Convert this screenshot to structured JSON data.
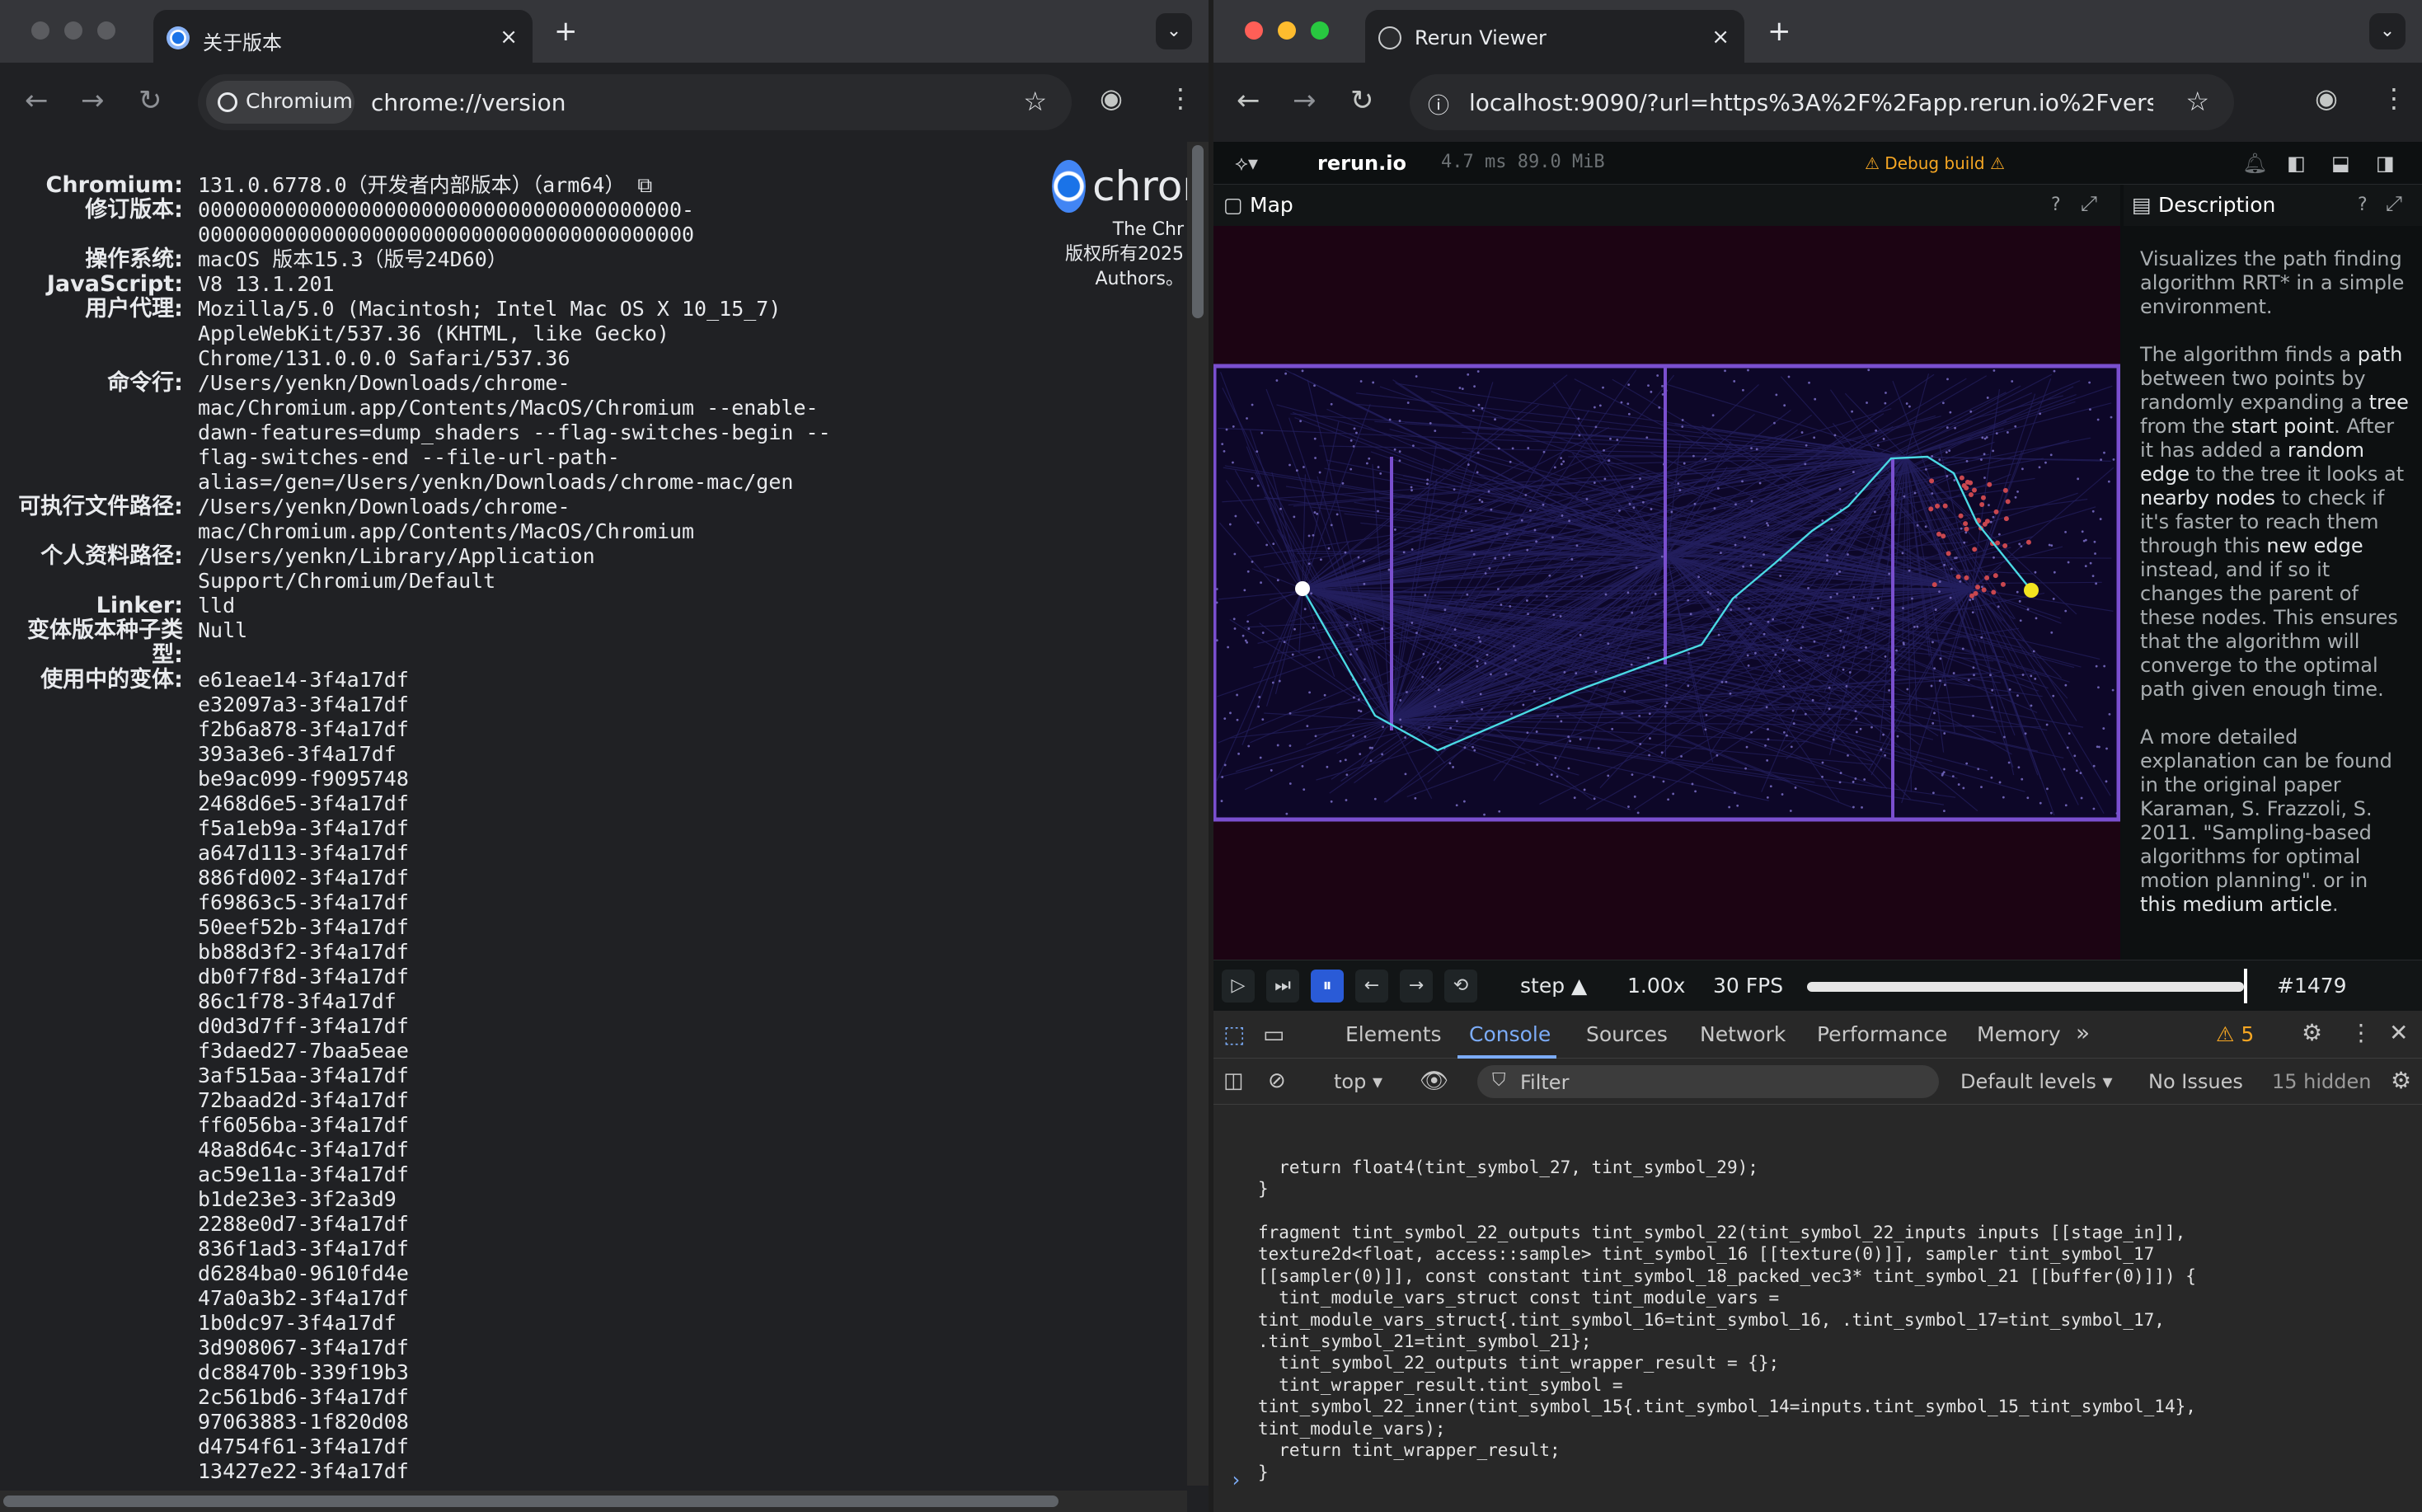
{
  "left_window": {
    "tab_title": "关于版本",
    "close": "×",
    "new_tab": "+",
    "dropdown": "⌄",
    "chip_label": "Chromium",
    "url": "chrome://version",
    "logo_text": "chron",
    "logo_caption": [
      "The Chr",
      "版权所有2025",
      "Authors。"
    ],
    "rows": [
      {
        "label": "Chromium:",
        "value": "131.0.6778.0（开发者内部版本）（arm64） ⧉"
      },
      {
        "label": "修订版本:",
        "value": "000000000000000000000000000000000000000-\n0000000000000000000000000000000000000000"
      },
      {
        "label": "操作系统:",
        "value": "macOS 版本15.3（版号24D60）"
      },
      {
        "label": "JavaScript:",
        "value": "V8 13.1.201"
      },
      {
        "label": "用户代理:",
        "value": "Mozilla/5.0 (Macintosh; Intel Mac OS X 10_15_7)\nAppleWebKit/537.36 (KHTML, like Gecko)\nChrome/131.0.0.0 Safari/537.36"
      },
      {
        "label": "命令行:",
        "value": "/Users/yenkn/Downloads/chrome-\nmac/Chromium.app/Contents/MacOS/Chromium --enable-\ndawn-features=dump_shaders --flag-switches-begin --\nflag-switches-end --file-url-path-\nalias=/gen=/Users/yenkn/Downloads/chrome-mac/gen"
      },
      {
        "label": "可执行文件路径:",
        "value": "/Users/yenkn/Downloads/chrome-\nmac/Chromium.app/Contents/MacOS/Chromium"
      },
      {
        "label": "个人资料路径:",
        "value": "/Users/yenkn/Library/Application\nSupport/Chromium/Default"
      },
      {
        "label": "Linker:",
        "value": "lld"
      },
      {
        "label": "变体版本种子类型:",
        "value": "Null"
      },
      {
        "label": "使用中的变体:",
        "value": "e61eae14-3f4a17df\ne32097a3-3f4a17df\nf2b6a878-3f4a17df\n393a3e6-3f4a17df\nbe9ac099-f9095748\n2468d6e5-3f4a17df\nf5a1eb9a-3f4a17df\na647d113-3f4a17df\n886fd002-3f4a17df\nf69863c5-3f4a17df\n50eef52b-3f4a17df\nbb88d3f2-3f4a17df\ndb0f7f8d-3f4a17df\n86c1f78-3f4a17df\nd0d3d7ff-3f4a17df\nf3daed27-7baa5eae\n3af515aa-3f4a17df\n72baad2d-3f4a17df\nff6056ba-3f4a17df\n48a8d64c-3f4a17df\nac59e11a-3f4a17df\nb1de23e3-3f2a3d9\n2288e0d7-3f4a17df\n836f1ad3-3f4a17df\nd6284ba0-9610fd4e\n47a0a3b2-3f4a17df\n1b0dc97-3f4a17df\n3d908067-3f4a17df\ndc88470b-339f19b3\n2c561bd6-3f4a17df\n97063883-1f820d08\nd4754f61-3f4a17df\n13427e22-3f4a17df"
      }
    ]
  },
  "right_window": {
    "tab_title": "Rerun Viewer",
    "close": "×",
    "new_tab": "+",
    "url": "localhost:9090/?url=https%3A%2F%2Fapp.rerun.io%2Fversion%...",
    "rerun": {
      "app_name": "rerun.io",
      "perf": "4.7 ms 89.0 MiB",
      "debug_badge": "⚠ Debug build ⚠",
      "map_title": "Map",
      "description_title": "Description",
      "help": "?",
      "description": [
        [
          {
            "t": "Visualizes the path finding algorithm RRT* in a simple environment.",
            "b": false
          }
        ],
        [
          {
            "t": "The algorithm finds a ",
            "b": false
          },
          {
            "t": "path",
            "b": true
          },
          {
            "t": " between two points by randomly expanding a ",
            "b": false
          },
          {
            "t": "tree",
            "b": true
          },
          {
            "t": " from the ",
            "b": false
          },
          {
            "t": "start point",
            "b": true
          },
          {
            "t": ". After it has added a ",
            "b": false
          },
          {
            "t": "random edge",
            "b": true
          },
          {
            "t": " to the tree it looks at ",
            "b": false
          },
          {
            "t": "nearby nodes",
            "b": true
          },
          {
            "t": " to check if it's faster to reach them through this ",
            "b": false
          },
          {
            "t": "new edge",
            "b": true
          },
          {
            "t": " instead, and if so it changes the parent of these nodes. This ensures that the algorithm will converge to the optimal path given enough time.",
            "b": false
          }
        ],
        [
          {
            "t": "A more detailed explanation can be found in the original paper Karaman, S. Frazzoli, S. 2011. \"Sampling-based algorithms for optimal motion planning\". or in ",
            "b": false
          },
          {
            "t": "this medium article",
            "b": true
          },
          {
            "t": ".",
            "b": false
          }
        ]
      ],
      "timebar": {
        "step_label": "step ▲",
        "speed": "1.00x",
        "fps": "30 FPS",
        "frame": "#1479"
      }
    },
    "devtools": {
      "tabs": [
        "Elements",
        "Console",
        "Sources",
        "Network",
        "Performance",
        "Memory"
      ],
      "active_tab": "Console",
      "more": "»",
      "warnings": "⚠ 5",
      "context": "top ▾",
      "filter_placeholder": "Filter",
      "levels": "Default levels ▾",
      "issues": "No Issues",
      "hidden": "15 hidden",
      "console_text": "  return float4(tint_symbol_27, tint_symbol_29);\n}\n\nfragment tint_symbol_22_outputs tint_symbol_22(tint_symbol_22_inputs inputs [[stage_in]],\ntexture2d<float, access::sample> tint_symbol_16 [[texture(0)]], sampler tint_symbol_17\n[[sampler(0)]], const constant tint_symbol_18_packed_vec3* tint_symbol_21 [[buffer(0)]]) {\n  tint_module_vars_struct const tint_module_vars =\ntint_module_vars_struct{.tint_symbol_16=tint_symbol_16, .tint_symbol_17=tint_symbol_17,\n.tint_symbol_21=tint_symbol_21};\n  tint_symbol_22_outputs tint_wrapper_result = {};\n  tint_wrapper_result.tint_symbol =\ntint_symbol_22_inner(tint_symbol_15{.tint_symbol_14=inputs.tint_symbol_15_tint_symbol_14},\ntint_module_vars);\n  return tint_wrapper_result;\n}",
      "prompt": "›"
    }
  },
  "colors": {
    "map_bg": "#1c0413",
    "wall": "#7a4fcf",
    "path": "#4ad9e4",
    "goal": "#f3e41f",
    "start": "#ffffff"
  }
}
